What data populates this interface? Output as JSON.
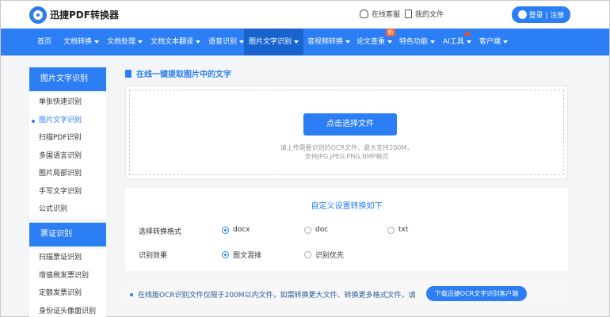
{
  "header": {
    "brand": "迅捷PDF转换器",
    "service": "在线客服",
    "my_files": "我的文件",
    "login": "登录 | 注册"
  },
  "nav": {
    "items": [
      {
        "label": "首页"
      },
      {
        "label": "文档转换"
      },
      {
        "label": "文档处理"
      },
      {
        "label": "文档文本翻译"
      },
      {
        "label": "语音识别"
      },
      {
        "label": "图片文字识别"
      },
      {
        "label": "音视频转换"
      },
      {
        "label": "论文查重"
      },
      {
        "label": "特色功能"
      },
      {
        "label": "AI工具"
      },
      {
        "label": "客户端"
      }
    ],
    "badge": "新"
  },
  "sidebar": {
    "section1_title": "图片文字识别",
    "section1_items": [
      "单张快速识别",
      "图片文字识别",
      "扫描PDF识别",
      "多国语言识别",
      "图片局部识别",
      "手写文字识别",
      "公式识别"
    ],
    "section2_title": "票证识别",
    "section2_items": [
      "扫描票证识别",
      "增值税发票识别",
      "定额发票识别",
      "身份证头像面识别"
    ]
  },
  "main": {
    "title": "在线一键提取图片中的文字",
    "upload_button": "点击选择文件",
    "hint_line1": "请上传需要识别的OCR文件，最大支持200M，",
    "hint_line2": "支持JPG,JPEG,PNG,BMP格式",
    "settings_title": "自定义设置转换如下",
    "format_label": "选择转换格式",
    "formats": [
      "docx",
      "doc",
      "txt"
    ],
    "effect_label": "识别效果",
    "effects": [
      "图文混排",
      "识别优先"
    ],
    "notice": "在线版OCR识别文件仅限于200M以内文件，如需转换更大文件、转换更多格式文件，请",
    "download_button": "下载迅捷OCR文字识别客户端"
  },
  "colors": {
    "primary": "#2b7ef3",
    "active_nav": "#1864cf",
    "badge": "#f2663d"
  }
}
